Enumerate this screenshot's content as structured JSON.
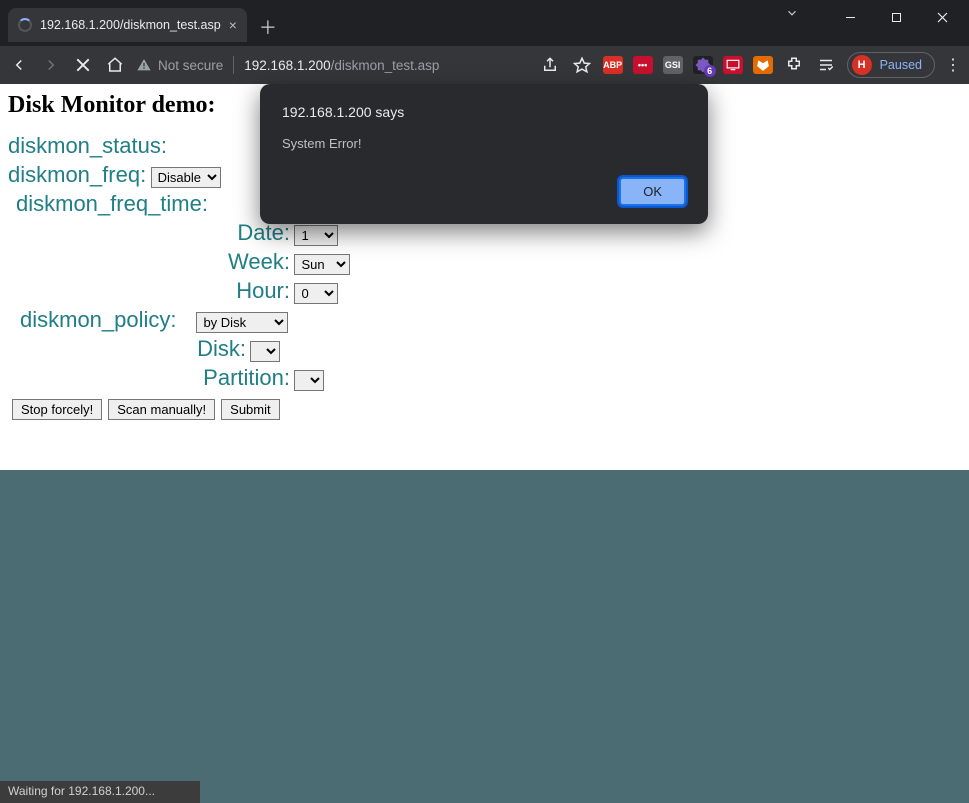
{
  "tab": {
    "title": "192.168.1.200/diskmon_test.asp"
  },
  "addressbar": {
    "not_secure": "Not secure",
    "url_host": "192.168.1.200",
    "url_path": "/diskmon_test.asp"
  },
  "profile": {
    "initial": "H",
    "paused_label": "Paused"
  },
  "ext_badge": "6",
  "page": {
    "title": "Disk Monitor demo:",
    "diskmon_status_label": "diskmon_status:",
    "diskmon_freq_label": "diskmon_freq:",
    "diskmon_freq_value": "Disable",
    "diskmon_freq_time_label": "diskmon_freq_time:",
    "date_label": "Date:",
    "date_value": "1",
    "week_label": "Week:",
    "week_value": "Sun",
    "hour_label": "Hour:",
    "hour_value": "0",
    "diskmon_policy_label": "diskmon_policy:",
    "diskmon_policy_value": "by Disk",
    "disk_label": "Disk:",
    "partition_label": "Partition:",
    "btn_stop": "Stop forcely!",
    "btn_scan": "Scan manually!",
    "btn_submit": "Submit"
  },
  "dialog": {
    "title": "192.168.1.200 says",
    "message": "System Error!",
    "ok": "OK"
  },
  "status": "Waiting for 192.168.1.200..."
}
